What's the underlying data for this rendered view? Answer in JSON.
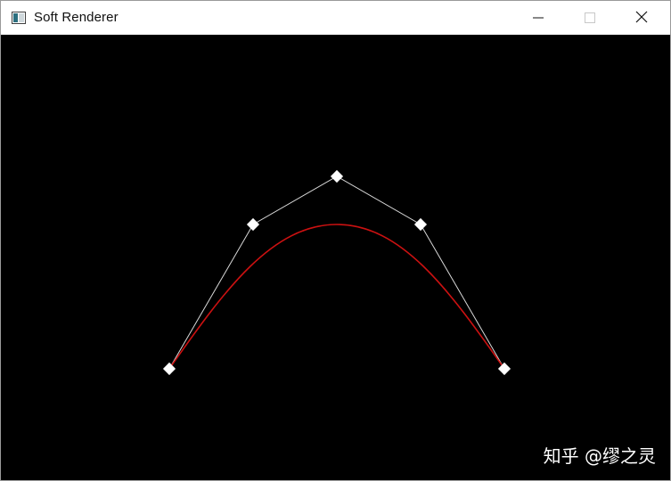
{
  "window": {
    "title": "Soft Renderer",
    "buttons": {
      "minimize_icon": "minimize-icon",
      "maximize_icon": "maximize-icon",
      "close_icon": "close-icon"
    },
    "app_icon": "window-app-icon"
  },
  "canvas": {
    "background_color": "#000000",
    "control_polygon_color": "#d8d8d8",
    "curve_color": "#cc1111",
    "control_point_color": "#ffffff",
    "control_point_shape": "diamond"
  },
  "watermark": {
    "text": "知乎 @缪之灵"
  }
}
